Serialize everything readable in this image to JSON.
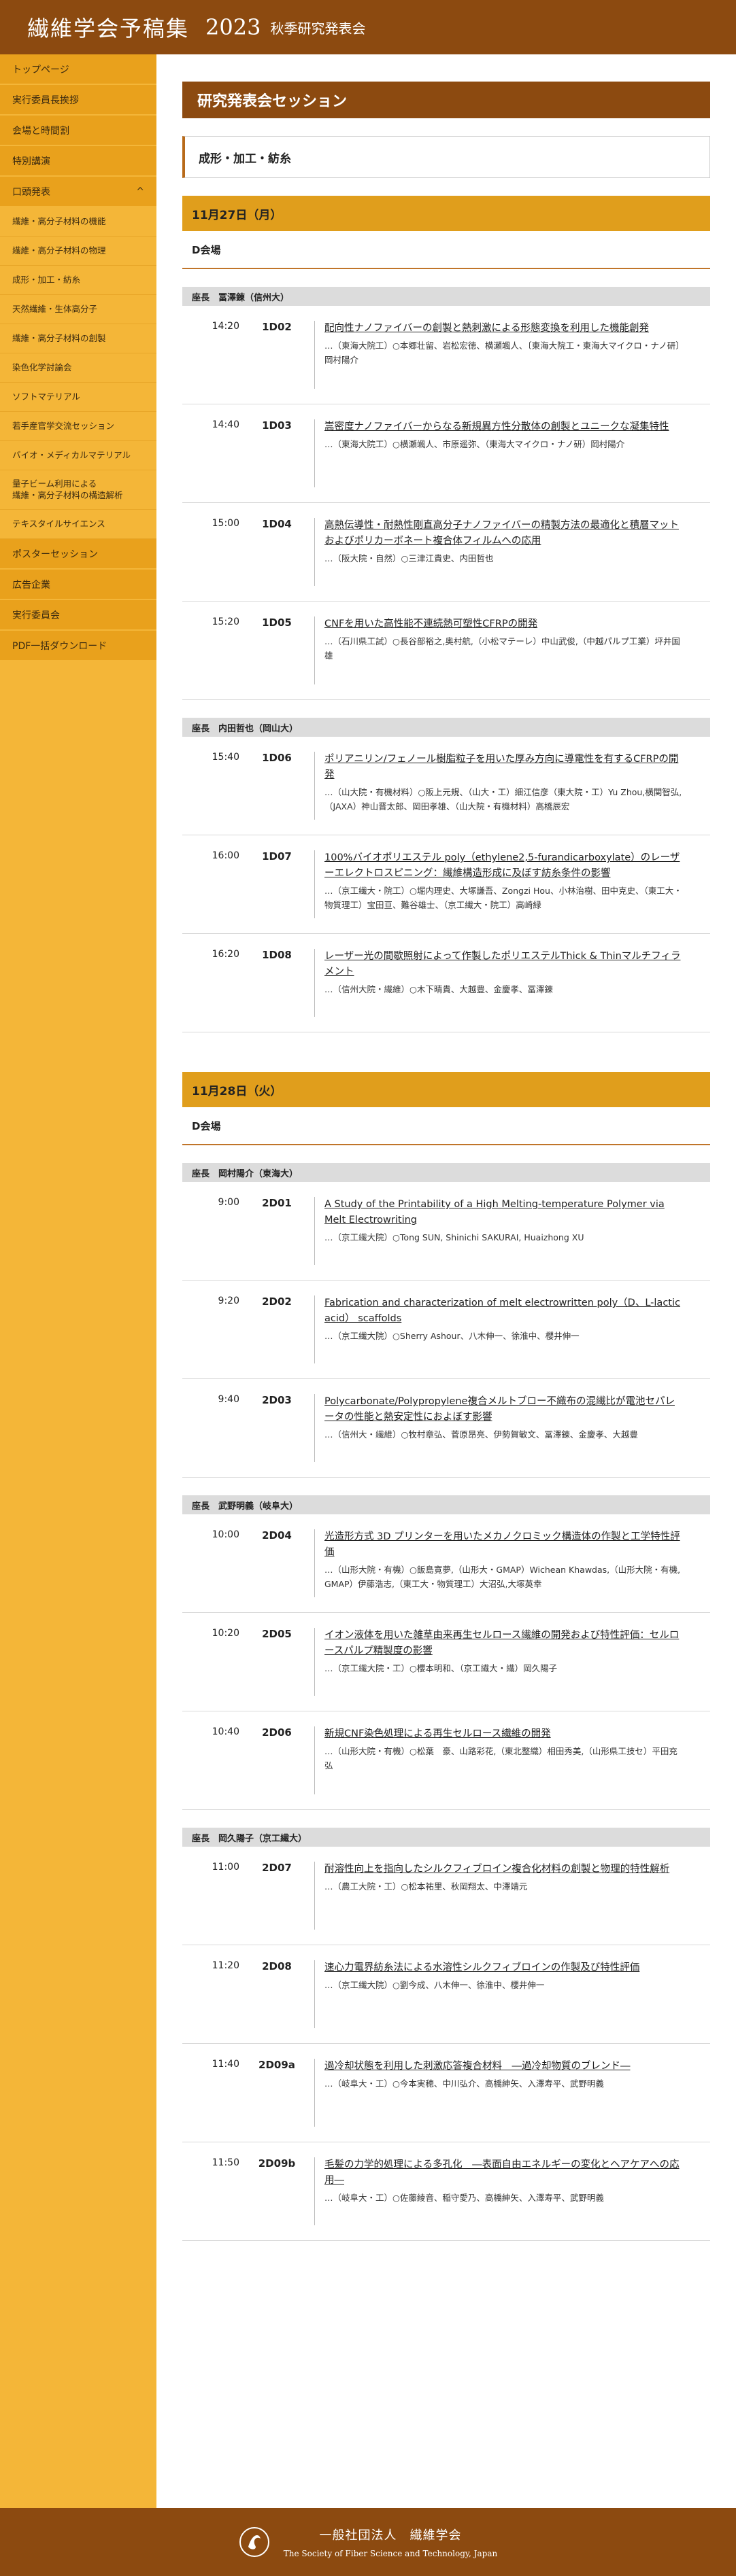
{
  "header": {
    "title": "繊維学会予稿集",
    "year": "2023",
    "subtitle": "秋季研究発表会"
  },
  "sidebar": {
    "items": [
      {
        "label": "トップページ",
        "type": "main"
      },
      {
        "label": "実行委員長挨拶",
        "type": "main"
      },
      {
        "label": "会場と時間割",
        "type": "main"
      },
      {
        "label": "特別講演",
        "type": "main"
      },
      {
        "label": "口頭発表",
        "type": "main",
        "chevron": "^"
      },
      {
        "label": "繊維・高分子材料の機能",
        "type": "sub"
      },
      {
        "label": "繊維・高分子材料の物理",
        "type": "sub"
      },
      {
        "label": "成形・加工・紡糸",
        "type": "sub"
      },
      {
        "label": "天然繊維・生体高分子",
        "type": "sub"
      },
      {
        "label": "繊維・高分子材料の創製",
        "type": "sub"
      },
      {
        "label": "染色化学討論会",
        "type": "sub"
      },
      {
        "label": "ソフトマテリアル",
        "type": "sub"
      },
      {
        "label": "若手産官学交流セッション",
        "type": "sub"
      },
      {
        "label": "バイオ・メディカルマテリアル",
        "type": "sub"
      },
      {
        "label": "量子ビーム利用による\n繊維・高分子材料の構造解析",
        "type": "sub",
        "tall": true
      },
      {
        "label": "テキスタイルサイエンス",
        "type": "sub"
      },
      {
        "label": "ポスターセッション",
        "type": "main"
      },
      {
        "label": "広告企業",
        "type": "main"
      },
      {
        "label": "実行委員会",
        "type": "main"
      },
      {
        "label": "PDF一括ダウンロード",
        "type": "main"
      }
    ]
  },
  "main": {
    "page_title": "研究発表会セッション",
    "topic": "成形・加工・紡糸",
    "days": [
      {
        "date": "11月27日（月）",
        "room": "D会場",
        "chairs": [
          {
            "label": "座長　冨澤錬（信州大）",
            "talks": [
              {
                "time": "14:20",
                "code": "1D02",
                "title": "配向性ナノファイバーの創製と熱刺激による形態変換を利用した機能創発",
                "authors": "…（東海大院工）○本郷壮留、岩松宏徳、横瀬颯人、〔東海大院工・東海大マイクロ・ナノ研〕岡村陽介"
              },
              {
                "time": "14:40",
                "code": "1D03",
                "title": "嵩密度ナノファイバーからなる新規異方性分散体の創製とユニークな凝集特性",
                "authors": "…（東海大院工）○横瀬颯人、市原遥弥、（東海大マイクロ・ナノ研）岡村陽介"
              },
              {
                "time": "15:00",
                "code": "1D04",
                "title": "高熱伝導性・耐熱性剛直高分子ナノファイバーの精製方法の最適化と積層マットおよびポリカーボネート複合体フィルムへの応用",
                "authors": "…（阪大院・自然）○三津江貴史、内田哲也"
              },
              {
                "time": "15:20",
                "code": "1D05",
                "title": "CNFを用いた高性能不連続熱可塑性CFRPの開発",
                "authors": "…（石川県工試）○長谷部裕之,奥村航,（小松マテーレ）中山武俊,（中越パルプ工業）坪井国雄"
              }
            ]
          },
          {
            "label": "座長　内田哲也（岡山大）",
            "talks": [
              {
                "time": "15:40",
                "code": "1D06",
                "title": "ポリアニリン/フェノール樹脂粒子を用いた厚み方向に導電性を有するCFRPの開発",
                "authors": "…（山大院・有機材料）○阪上元規、（山大・工）細江信彦（東大院・工）Yu Zhou,横関智弘,（JAXA）神山晋太郎、岡田孝雄、（山大院・有機材料）高橋辰宏"
              },
              {
                "time": "16:00",
                "code": "1D07",
                "title": "100%バイオポリエステル poly（ethylene2,5-furandicarboxylate）のレーザーエレクトロスピニング：繊維構造形成に及ぼす紡糸条件の影響",
                "authors": "…（京工繊大・院工）○堀内理史、大塚謙吾、Zongzi Hou、小林治樹、田中克史、（東工大・物質理工）宝田亘、難谷雄士、（京工繊大・院工）高崎緑"
              },
              {
                "time": "16:20",
                "code": "1D08",
                "title": "レーザー光の間歇照射によって作製したポリエステルThick & Thinマルチフィラメント",
                "authors": "…（信州大院・繊維）○木下晴貴、大越豊、金慶孝、冨澤錬"
              }
            ]
          }
        ]
      },
      {
        "date": "11月28日（火）",
        "room": "D会場",
        "chairs": [
          {
            "label": "座長　岡村陽介（東海大）",
            "talks": [
              {
                "time": "9:00",
                "code": "2D01",
                "title": "A Study of the Printability of a High Melting-temperature Polymer via Melt Electrowriting",
                "authors": "…（京工繊大院）○Tong SUN, Shinichi SAKURAI, Huaizhong XU"
              },
              {
                "time": "9:20",
                "code": "2D02",
                "title": "Fabrication and characterization of melt electrowritten poly（D、L-lactic acid） scaffolds",
                "authors": "…（京工繊大院）○Sherry Ashour、八木伸一、徐淮中、櫻井伸一"
              },
              {
                "time": "9:40",
                "code": "2D03",
                "title": "Polycarbonate/Polypropylene複合メルトブロー不織布の混繊比が電池セパレータの性能と熱安定性におよぼす影響",
                "authors": "…（信州大・繊維）○牧村章弘、菅原昂亮、伊勢賀敏文、冨澤錬、金慶孝、大越豊"
              }
            ]
          },
          {
            "label": "座長　武野明義（岐阜大）",
            "talks": [
              {
                "time": "10:00",
                "code": "2D04",
                "title": "光造形方式 3D プリンターを用いたメカノクロミック構造体の作製と工学特性評価",
                "authors": "…（山形大院・有機）○飯島寛夢,（山形大・GMAP）Wichean Khawdas,（山形大院・有機, GMAP）伊藤浩志,（東工大・物質理工）大沼弘,大塚英幸"
              },
              {
                "time": "10:20",
                "code": "2D05",
                "title": "イオン液体を用いた雑草由来再生セルロース繊維の開発および特性評価：セルロースパルプ精製度の影響",
                "authors": "…（京工繊大院・工）○櫻本明和、（京工繊大・繊）岡久陽子"
              },
              {
                "time": "10:40",
                "code": "2D06",
                "title": "新規CNF染色処理による再生セルロース繊維の開発",
                "authors": "…（山形大院・有機）○松葉　豪、山路彩花,（東北整織）相田秀美,（山形県工技セ）平田充弘"
              }
            ]
          },
          {
            "label": "座長　岡久陽子（京工繊大）",
            "talks": [
              {
                "time": "11:00",
                "code": "2D07",
                "title": "耐溶性向上を指向したシルクフィブロイン複合化材料の創製と物理的特性解析",
                "authors": "…（農工大院・工）○松本祐里、秋岡翔太、中澤靖元"
              },
              {
                "time": "11:20",
                "code": "2D08",
                "title": "速心力電界紡糸法による水溶性シルクフィブロインの作製及び特性評価",
                "authors": "…（京工繊大院）○劉今成、八木伸一、徐淮中、櫻井伸一"
              },
              {
                "time": "11:40",
                "code": "2D09a",
                "title": "過冷却状態を利用した刺激応答複合材料　―過冷却物質のブレンド―",
                "authors": "…（岐阜大・工）○今本実穂、中川弘介、高橋紳矢、入澤寿平、武野明義"
              },
              {
                "time": "11:50",
                "code": "2D09b",
                "title": "毛髪の力学的処理による多孔化　―表面自由エネルギーの変化とヘアケアへの応用―",
                "authors": "…（岐阜大・工）○佐藤綾音、稲守愛乃、高橋紳矢、入澤寿平、武野明義"
              }
            ]
          }
        ]
      }
    ]
  },
  "footer": {
    "org_jp": "一般社団法人　繊維学会",
    "org_en": "The Society of Fiber Science and Technology, Japan"
  },
  "colors": {
    "header": "#8c4a10",
    "accent": "#e09e1c",
    "sidebar": "#f4b638"
  }
}
